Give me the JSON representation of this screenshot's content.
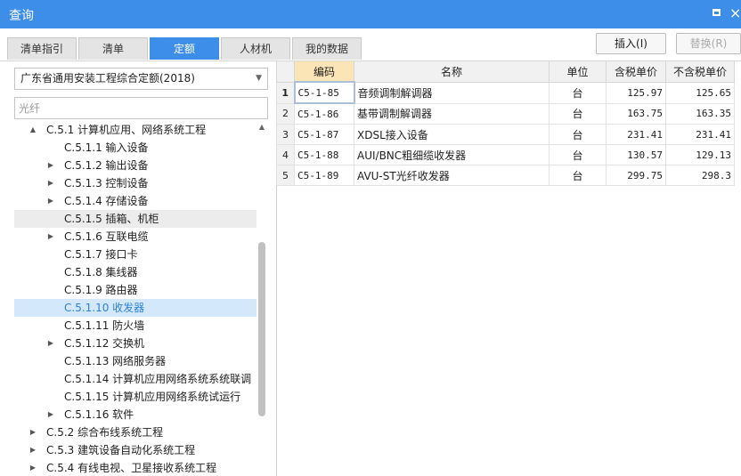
{
  "window": {
    "title": "查询"
  },
  "tabs": [
    {
      "label": "清单指引"
    },
    {
      "label": "清单"
    },
    {
      "label": "定额",
      "active": true
    },
    {
      "label": "人材机"
    },
    {
      "label": "我的数据"
    }
  ],
  "toolbar": {
    "insert_label": "插入(I)",
    "replace_label": "替换(R)"
  },
  "left": {
    "library_select": "广东省通用安装工程综合定额(2018)",
    "search_placeholder": "光纤"
  },
  "tree": [
    {
      "label": "C.5.1 计算机应用、网络系统工程",
      "level": 0,
      "toggle": "▲"
    },
    {
      "label": "C.5.1.1 输入设备",
      "level": 1,
      "toggle": ""
    },
    {
      "label": "C.5.1.2 输出设备",
      "level": 1,
      "toggle": "▶"
    },
    {
      "label": "C.5.1.3 控制设备",
      "level": 1,
      "toggle": "▶"
    },
    {
      "label": "C.5.1.4 存储设备",
      "level": 1,
      "toggle": "▶"
    },
    {
      "label": "C.5.1.5 插箱、机柜",
      "level": 1,
      "toggle": "",
      "state": "hover"
    },
    {
      "label": "C.5.1.6 互联电缆",
      "level": 1,
      "toggle": "▶"
    },
    {
      "label": "C.5.1.7 接口卡",
      "level": 1,
      "toggle": ""
    },
    {
      "label": "C.5.1.8 集线器",
      "level": 1,
      "toggle": ""
    },
    {
      "label": "C.5.1.9 路由器",
      "level": 1,
      "toggle": ""
    },
    {
      "label": "C.5.1.10 收发器",
      "level": 1,
      "toggle": "",
      "state": "selected"
    },
    {
      "label": "C.5.1.11 防火墙",
      "level": 1,
      "toggle": ""
    },
    {
      "label": "C.5.1.12 交换机",
      "level": 1,
      "toggle": "▶"
    },
    {
      "label": "C.5.1.13 网络服务器",
      "level": 1,
      "toggle": ""
    },
    {
      "label": "C.5.1.14 计算机应用网络系统系统联调",
      "level": 1,
      "toggle": ""
    },
    {
      "label": "C.5.1.15 计算机应用网络系统试运行",
      "level": 1,
      "toggle": ""
    },
    {
      "label": "C.5.1.16 软件",
      "level": 1,
      "toggle": "▶"
    },
    {
      "label": "C.5.2 综合布线系统工程",
      "level": 0,
      "toggle": "▶"
    },
    {
      "label": "C.5.3 建筑设备自动化系统工程",
      "level": 0,
      "toggle": "▶"
    },
    {
      "label": "C.5.4 有线电视、卫星接收系统工程",
      "level": 0,
      "toggle": "▶"
    }
  ],
  "table": {
    "columns": [
      "编码",
      "名称",
      "单位",
      "含税单价",
      "不含税单价"
    ],
    "rows": [
      {
        "n": "1",
        "code": "C5-1-85",
        "name": "音频调制解调器",
        "unit": "台",
        "price_tax": "125.97",
        "price_notax": "125.65"
      },
      {
        "n": "2",
        "code": "C5-1-86",
        "name": "基带调制解调器",
        "unit": "台",
        "price_tax": "163.75",
        "price_notax": "163.35"
      },
      {
        "n": "3",
        "code": "C5-1-87",
        "name": "XDSL接入设备",
        "unit": "台",
        "price_tax": "231.41",
        "price_notax": "231.41"
      },
      {
        "n": "4",
        "code": "C5-1-88",
        "name": "AUI/BNC粗细缆收发器",
        "unit": "台",
        "price_tax": "130.57",
        "price_notax": "129.13"
      },
      {
        "n": "5",
        "code": "C5-1-89",
        "name": "AVU-ST光纤收发器",
        "unit": "台",
        "price_tax": "299.75",
        "price_notax": "298.3"
      }
    ]
  }
}
